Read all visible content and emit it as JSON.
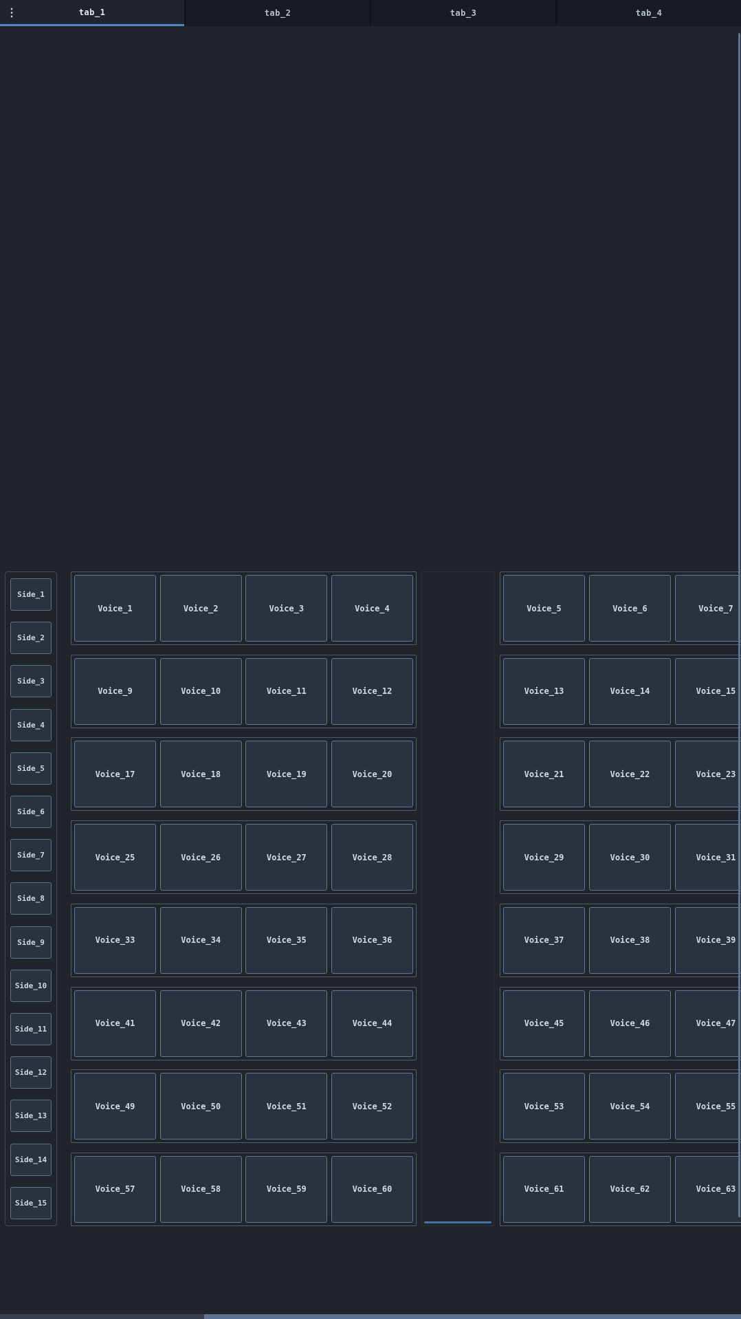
{
  "colors": {
    "background": "#20242b",
    "tabbar_background": "#101216",
    "active_tab_accent": "#4c8bd2",
    "button_fill": "#2b323f",
    "button_border": "#647798",
    "group_border": "#4e5b70",
    "scrollbar_thumb": "#5d7392",
    "divider_accent": "#4272a8"
  },
  "tabbar": {
    "menu_icon": "kebab-vertical-icon",
    "menu_glyph": "⋮",
    "tabs": [
      {
        "label": "tab_1",
        "active": true
      },
      {
        "label": "tab_2",
        "active": false
      },
      {
        "label": "tab_3",
        "active": false
      },
      {
        "label": "tab_4",
        "active": false
      }
    ]
  },
  "sidebar": {
    "buttons": [
      "Side_1",
      "Side_2",
      "Side_3",
      "Side_4",
      "Side_5",
      "Side_6",
      "Side_7",
      "Side_8",
      "Side_9",
      "Side_10",
      "Side_11",
      "Side_12",
      "Side_13",
      "Side_14",
      "Side_15"
    ]
  },
  "left_grid": {
    "rows": [
      [
        "Voice_1",
        "Voice_2",
        "Voice_3",
        "Voice_4"
      ],
      [
        "Voice_9",
        "Voice_10",
        "Voice_11",
        "Voice_12"
      ],
      [
        "Voice_17",
        "Voice_18",
        "Voice_19",
        "Voice_20"
      ],
      [
        "Voice_25",
        "Voice_26",
        "Voice_27",
        "Voice_28"
      ],
      [
        "Voice_33",
        "Voice_34",
        "Voice_35",
        "Voice_36"
      ],
      [
        "Voice_41",
        "Voice_42",
        "Voice_43",
        "Voice_44"
      ],
      [
        "Voice_49",
        "Voice_50",
        "Voice_51",
        "Voice_52"
      ],
      [
        "Voice_57",
        "Voice_58",
        "Voice_59",
        "Voice_60"
      ]
    ]
  },
  "right_grid": {
    "rows": [
      [
        "Voice_5",
        "Voice_6",
        "Voice_7"
      ],
      [
        "Voice_13",
        "Voice_14",
        "Voice_15"
      ],
      [
        "Voice_21",
        "Voice_22",
        "Voice_23"
      ],
      [
        "Voice_29",
        "Voice_30",
        "Voice_31"
      ],
      [
        "Voice_37",
        "Voice_38",
        "Voice_39"
      ],
      [
        "Voice_45",
        "Voice_46",
        "Voice_47"
      ],
      [
        "Voice_53",
        "Voice_54",
        "Voice_55"
      ],
      [
        "Voice_61",
        "Voice_62",
        "Voice_63"
      ]
    ]
  }
}
